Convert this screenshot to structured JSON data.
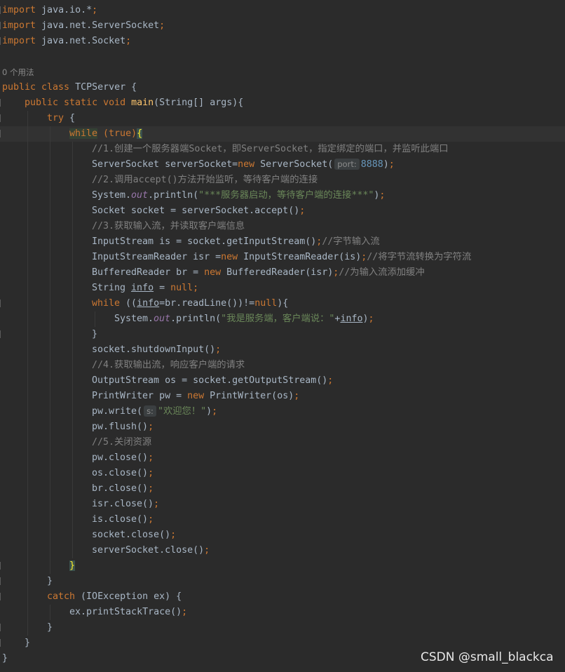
{
  "editor": {
    "file_language": "java",
    "colors": {
      "background": "#2b2b2b",
      "default": "#a9b7c6",
      "keyword": "#cc7832",
      "comment": "#808080",
      "number": "#6897bb",
      "string": "#6a8759",
      "method": "#ffc66d",
      "field": "#9876aa",
      "hint": "#8c8c8c"
    },
    "lines": [
      {
        "name": "import-java-io",
        "indent": 0,
        "fold": true,
        "tokens": [
          {
            "t": "import",
            "c": "kw"
          },
          {
            "t": " java.io.*"
          },
          {
            "t": ";",
            "c": "kw"
          }
        ]
      },
      {
        "name": "import-serversocket",
        "indent": 0,
        "fold": true,
        "tokens": [
          {
            "t": "import",
            "c": "kw"
          },
          {
            "t": " java.net.ServerSocket"
          },
          {
            "t": ";",
            "c": "kw"
          }
        ]
      },
      {
        "name": "import-socket",
        "indent": 0,
        "fold": true,
        "tokens": [
          {
            "t": "import",
            "c": "kw"
          },
          {
            "t": " java.net.Socket"
          },
          {
            "t": ";",
            "c": "kw"
          }
        ]
      },
      {
        "name": "blank",
        "indent": 0,
        "tokens": []
      },
      {
        "name": "usage-hint",
        "indent": 0,
        "tokens": [
          {
            "t": "0 个用法",
            "c": "usage"
          }
        ]
      },
      {
        "name": "class-declaration",
        "indent": 0,
        "tokens": [
          {
            "t": "public class ",
            "c": "kw"
          },
          {
            "t": "TCPServer {"
          }
        ]
      },
      {
        "name": "main-method-declaration",
        "indent": 1,
        "fold": true,
        "tokens": [
          {
            "t": "public static void ",
            "c": "kw"
          },
          {
            "t": "main",
            "c": "fn"
          },
          {
            "t": "(String[] args){"
          }
        ]
      },
      {
        "name": "try-block",
        "indent": 2,
        "fold": true,
        "tokens": [
          {
            "t": "try ",
            "c": "kw"
          },
          {
            "t": "{"
          }
        ]
      },
      {
        "name": "while-true",
        "indent": 3,
        "fold": true,
        "caret": true,
        "tokens": [
          {
            "t": "while",
            "c": "kw-hl"
          },
          {
            "t": " (",
            "c": "kw"
          },
          {
            "t": "true",
            "c": "kw"
          },
          {
            "t": ")",
            "c": "kw"
          },
          {
            "t": "{",
            "c": "brace-hl"
          }
        ]
      },
      {
        "name": "comment-step-1",
        "indent": 4,
        "tokens": [
          {
            "t": "//1.创建一个服务器端Socket，即ServerSocket，指定绑定的端口，并监听此端口",
            "c": "cm"
          }
        ]
      },
      {
        "name": "serversocket-new",
        "indent": 4,
        "tokens": [
          {
            "t": "ServerSocket serverSocket="
          },
          {
            "t": "new ",
            "c": "kw"
          },
          {
            "t": "ServerSocket("
          },
          {
            "t": "port:",
            "c": "hint"
          },
          {
            "t": "8888",
            "c": "num"
          },
          {
            "t": ");",
            "c": "kw-semi"
          }
        ]
      },
      {
        "name": "comment-step-2",
        "indent": 4,
        "tokens": [
          {
            "t": "//2.调用accept()方法开始监听，等待客户端的连接",
            "c": "cm"
          }
        ]
      },
      {
        "name": "println-start",
        "indent": 4,
        "tokens": [
          {
            "t": "System."
          },
          {
            "t": "out",
            "c": "field"
          },
          {
            "t": ".println("
          },
          {
            "t": "\"***服务器启动，等待客户端的连接***\"",
            "c": "str"
          },
          {
            "t": ");",
            "c": "kw-semi"
          }
        ]
      },
      {
        "name": "socket-accept",
        "indent": 4,
        "tokens": [
          {
            "t": "Socket socket = serverSocket.accept()"
          },
          {
            "t": ";",
            "c": "kw"
          }
        ]
      },
      {
        "name": "comment-step-3",
        "indent": 4,
        "tokens": [
          {
            "t": "//3.获取输入流，并读取客户端信息",
            "c": "cm"
          }
        ]
      },
      {
        "name": "inputstream",
        "indent": 4,
        "tokens": [
          {
            "t": "InputStream is = socket.getInputStream()"
          },
          {
            "t": ";",
            "c": "kw"
          },
          {
            "t": "//字节输入流",
            "c": "cm"
          }
        ]
      },
      {
        "name": "inputstreamreader",
        "indent": 4,
        "tokens": [
          {
            "t": "InputStreamReader isr ="
          },
          {
            "t": "new ",
            "c": "kw"
          },
          {
            "t": "InputStreamReader(is)"
          },
          {
            "t": ";",
            "c": "kw"
          },
          {
            "t": "//将字节流转换为字符流",
            "c": "cm"
          }
        ]
      },
      {
        "name": "bufferedreader",
        "indent": 4,
        "tokens": [
          {
            "t": "BufferedReader br = "
          },
          {
            "t": "new ",
            "c": "kw"
          },
          {
            "t": "BufferedReader(isr)"
          },
          {
            "t": ";",
            "c": "kw"
          },
          {
            "t": "//为输入流添加缓冲",
            "c": "cm"
          }
        ]
      },
      {
        "name": "string-info",
        "indent": 4,
        "tokens": [
          {
            "t": "String "
          },
          {
            "t": "info",
            "c": "ul"
          },
          {
            "t": " = "
          },
          {
            "t": "null",
            "c": "kw"
          },
          {
            "t": ";",
            "c": "kw"
          }
        ]
      },
      {
        "name": "while-readline",
        "indent": 4,
        "fold": true,
        "tokens": [
          {
            "t": "while ",
            "c": "kw"
          },
          {
            "t": "(("
          },
          {
            "t": "info",
            "c": "ul"
          },
          {
            "t": "=br.readLine())!="
          },
          {
            "t": "null",
            "c": "kw"
          },
          {
            "t": "){"
          }
        ]
      },
      {
        "name": "println-info",
        "indent": 5,
        "tokens": [
          {
            "t": "System."
          },
          {
            "t": "out",
            "c": "field"
          },
          {
            "t": ".println("
          },
          {
            "t": "\"我是服务端，客户端说：\"",
            "c": "str"
          },
          {
            "t": "+"
          },
          {
            "t": "info",
            "c": "ul"
          },
          {
            "t": ");",
            "c": "kw-semi"
          }
        ]
      },
      {
        "name": "close-while-readline",
        "indent": 4,
        "fold": true,
        "tokens": [
          {
            "t": "}"
          }
        ]
      },
      {
        "name": "shutdown-input",
        "indent": 4,
        "tokens": [
          {
            "t": "socket.shutdownInput()"
          },
          {
            "t": ";",
            "c": "kw"
          }
        ]
      },
      {
        "name": "comment-step-4",
        "indent": 4,
        "tokens": [
          {
            "t": "//4.获取输出流，响应客户端的请求",
            "c": "cm"
          }
        ]
      },
      {
        "name": "outputstream",
        "indent": 4,
        "tokens": [
          {
            "t": "OutputStream os = socket.getOutputStream()"
          },
          {
            "t": ";",
            "c": "kw"
          }
        ]
      },
      {
        "name": "printwriter",
        "indent": 4,
        "tokens": [
          {
            "t": "PrintWriter pw = "
          },
          {
            "t": "new ",
            "c": "kw"
          },
          {
            "t": "PrintWriter(os)"
          },
          {
            "t": ";",
            "c": "kw"
          }
        ]
      },
      {
        "name": "pw-write",
        "indent": 4,
        "tokens": [
          {
            "t": "pw.write("
          },
          {
            "t": "s:",
            "c": "hint"
          },
          {
            "t": "\"欢迎您！\"",
            "c": "str"
          },
          {
            "t": ");",
            "c": "kw-semi"
          }
        ]
      },
      {
        "name": "pw-flush",
        "indent": 4,
        "tokens": [
          {
            "t": "pw.flush()"
          },
          {
            "t": ";",
            "c": "kw"
          }
        ]
      },
      {
        "name": "comment-step-5",
        "indent": 4,
        "tokens": [
          {
            "t": "//5.关闭资源",
            "c": "cm"
          }
        ]
      },
      {
        "name": "pw-close",
        "indent": 4,
        "tokens": [
          {
            "t": "pw.close()"
          },
          {
            "t": ";",
            "c": "kw"
          }
        ]
      },
      {
        "name": "os-close",
        "indent": 4,
        "tokens": [
          {
            "t": "os.close()"
          },
          {
            "t": ";",
            "c": "kw"
          }
        ]
      },
      {
        "name": "br-close",
        "indent": 4,
        "tokens": [
          {
            "t": "br.close()"
          },
          {
            "t": ";",
            "c": "kw"
          }
        ]
      },
      {
        "name": "isr-close",
        "indent": 4,
        "tokens": [
          {
            "t": "isr.close()"
          },
          {
            "t": ";",
            "c": "kw"
          }
        ]
      },
      {
        "name": "is-close",
        "indent": 4,
        "tokens": [
          {
            "t": "is.close()"
          },
          {
            "t": ";",
            "c": "kw"
          }
        ]
      },
      {
        "name": "socket-close",
        "indent": 4,
        "tokens": [
          {
            "t": "socket.close()"
          },
          {
            "t": ";",
            "c": "kw"
          }
        ]
      },
      {
        "name": "serversocket-close",
        "indent": 4,
        "tokens": [
          {
            "t": "serverSocket.close()"
          },
          {
            "t": ";",
            "c": "kw"
          }
        ]
      },
      {
        "name": "close-while-true",
        "indent": 3,
        "fold": true,
        "tokens": [
          {
            "t": "}",
            "c": "brace-hl"
          }
        ]
      },
      {
        "name": "close-try",
        "indent": 2,
        "fold": true,
        "tokens": [
          {
            "t": "}"
          }
        ]
      },
      {
        "name": "catch-block",
        "indent": 2,
        "fold": true,
        "tokens": [
          {
            "t": "catch ",
            "c": "kw"
          },
          {
            "t": "(IOException ex) {"
          }
        ]
      },
      {
        "name": "print-stack-trace",
        "indent": 3,
        "tokens": [
          {
            "t": "ex.printStackTrace()"
          },
          {
            "t": ";",
            "c": "kw"
          }
        ]
      },
      {
        "name": "close-catch",
        "indent": 2,
        "fold": true,
        "tokens": [
          {
            "t": "}"
          }
        ]
      },
      {
        "name": "close-main",
        "indent": 1,
        "fold": true,
        "tokens": [
          {
            "t": "}"
          }
        ]
      },
      {
        "name": "close-class",
        "indent": 0,
        "tokens": [
          {
            "t": "}"
          }
        ]
      }
    ]
  },
  "watermark": {
    "text": "CSDN @small_blackca"
  }
}
